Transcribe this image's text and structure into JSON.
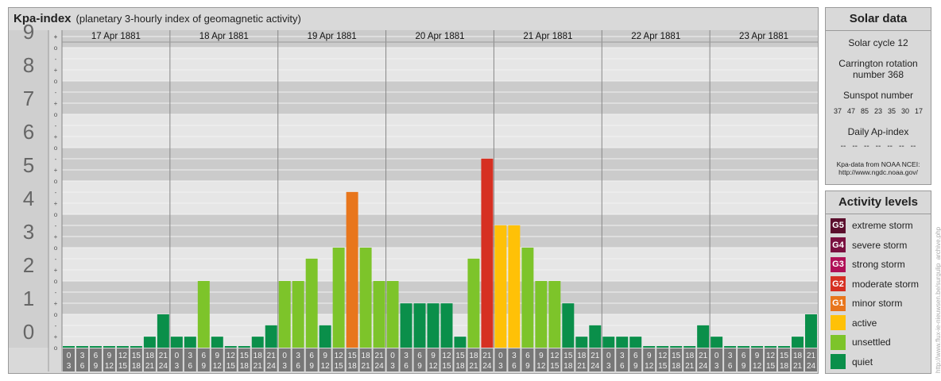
{
  "header": {
    "title": "Kpa-index",
    "subtitle": "(planetary 3-hourly index of geomagnetic activity)"
  },
  "solar": {
    "title": "Solar data",
    "cycle": "Solar cycle 12",
    "carrington": "Carrington rotation number 368",
    "sunspot_label": "Sunspot number",
    "sunspot_values": [
      "37",
      "47",
      "85",
      "23",
      "35",
      "30",
      "17"
    ],
    "ap_label": "Daily Ap-index",
    "ap_values": [
      "--",
      "--",
      "--",
      "--",
      "--",
      "--",
      "--"
    ],
    "source_line1": "Kpa-data from NOAA NCEI:",
    "source_line2": "http://www.ngdc.noaa.gov/"
  },
  "levels": {
    "title": "Activity levels",
    "items": [
      {
        "badge": "G5",
        "label": "extreme storm",
        "color": "#5b0e2d"
      },
      {
        "badge": "G4",
        "label": "severe storm",
        "color": "#7a1040"
      },
      {
        "badge": "G3",
        "label": "strong storm",
        "color": "#b01057"
      },
      {
        "badge": "G2",
        "label": "moderate storm",
        "color": "#d63022"
      },
      {
        "badge": "G1",
        "label": "minor storm",
        "color": "#e8761c"
      },
      {
        "badge": "",
        "label": "active",
        "color": "#ffc107"
      },
      {
        "badge": "",
        "label": "unsettled",
        "color": "#7dc42a"
      },
      {
        "badge": "",
        "label": "quiet",
        "color": "#0a8f4a"
      }
    ]
  },
  "credit": "http://www.flux-ie-nieuwsen.be/surgulip_archive.php",
  "chart_data": {
    "type": "bar",
    "days": [
      "17 Apr 1881",
      "18 Apr 1881",
      "19 Apr 1881",
      "20 Apr 1881",
      "21 Apr 1881",
      "22 Apr 1881",
      "23 Apr 1881"
    ],
    "y_levels": [
      "0",
      "1",
      "2",
      "3",
      "4",
      "5",
      "6",
      "7",
      "8",
      "9"
    ],
    "y_sublabels": [
      "o",
      "+",
      "-"
    ],
    "slot_start": [
      "0",
      "3",
      "6",
      "9",
      "12",
      "15",
      "18",
      "21"
    ],
    "slot_end": [
      "3",
      "6",
      "9",
      "12",
      "15",
      "18",
      "21",
      "24"
    ],
    "ylim": [
      0,
      9.33
    ],
    "values": [
      0,
      0,
      0,
      0,
      0,
      0,
      0.33,
      1,
      0.33,
      0.33,
      2,
      0.33,
      0,
      0,
      0.33,
      0.67,
      2,
      2,
      2.67,
      0.67,
      3,
      4.67,
      3,
      2,
      2,
      1.33,
      1.33,
      1.33,
      1.33,
      0.33,
      2.67,
      5.67,
      3.67,
      3.67,
      3,
      2,
      2,
      1.33,
      0.33,
      0.67,
      0.33,
      0.33,
      0.33,
      0,
      0,
      0,
      0,
      0.67,
      0.33,
      0,
      0,
      0,
      0,
      0,
      0.33,
      1
    ]
  }
}
